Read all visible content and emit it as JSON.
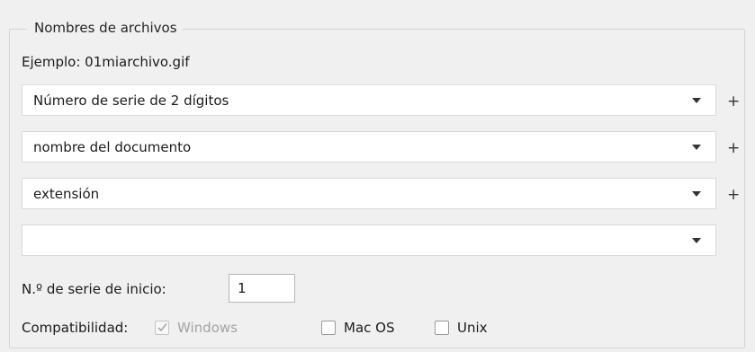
{
  "group": {
    "title": "Nombres de archivos",
    "example": "Ejemplo: 01miarchivo.gif"
  },
  "name_parts": [
    {
      "value": "Número de serie de 2 dígitos",
      "has_plus": true
    },
    {
      "value": "nombre del documento",
      "has_plus": true
    },
    {
      "value": "extensión",
      "has_plus": true
    },
    {
      "value": "",
      "has_plus": false
    }
  ],
  "plus_symbol": "+",
  "start_serial": {
    "label": "N.º de serie de inicio:",
    "value": "1"
  },
  "compatibility": {
    "label": "Compatibilidad:",
    "options": [
      {
        "label": "Windows",
        "checked": true,
        "disabled": true
      },
      {
        "label": "Mac OS",
        "checked": false,
        "disabled": false
      },
      {
        "label": "Unix",
        "checked": false,
        "disabled": false
      }
    ]
  },
  "icons": {
    "dropdown": "caret-down-icon",
    "add": "plus-icon",
    "check": "checkmark-icon"
  },
  "colors": {
    "background": "#f0f0f0",
    "field": "#ffffff",
    "disabled_text": "#a3a3a3"
  }
}
